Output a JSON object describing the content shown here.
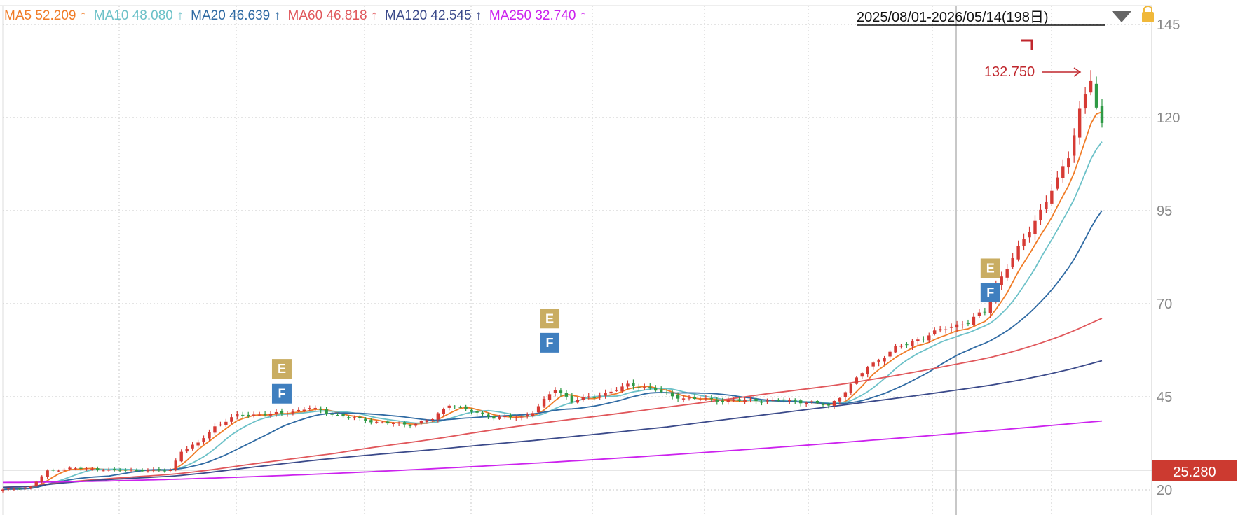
{
  "legend": [
    {
      "label": "MA5",
      "value": "52.209",
      "arrow": "↑",
      "color": "#f07c27"
    },
    {
      "label": "MA10",
      "value": "48.080",
      "arrow": "↑",
      "color": "#6cc1c8"
    },
    {
      "label": "MA20",
      "value": "46.639",
      "arrow": "↑",
      "color": "#2f6aa3"
    },
    {
      "label": "MA60",
      "value": "46.818",
      "arrow": "↑",
      "color": "#e0575b"
    },
    {
      "label": "MA120",
      "value": "42.545",
      "arrow": "↑",
      "color": "#3b4a8a"
    },
    {
      "label": "MA250",
      "value": "32.740",
      "arrow": "↑",
      "color": "#cc22ee"
    }
  ],
  "range_label": "2025/08/01-2026/05/14(198日)",
  "dropdown_icon": "triangle-down-icon",
  "lock_icon": "lock-icon",
  "high_label": "132.750",
  "current_price": "25.280",
  "colors": {
    "up": "#d63a34",
    "down": "#2e9a45",
    "price_tag": "#cc3a30",
    "marker_E": "#c9ad62",
    "marker_F": "#3f7fbf"
  },
  "markers": [
    {
      "label": "E",
      "index": 50,
      "price": 52.5
    },
    {
      "label": "F",
      "index": 50,
      "price": 45.8
    },
    {
      "label": "E",
      "index": 98,
      "price": 66.0
    },
    {
      "label": "F",
      "index": 98,
      "price": 59.5
    },
    {
      "label": "E",
      "index": 177,
      "price": 79.5
    },
    {
      "label": "F",
      "index": 177,
      "price": 73.0
    }
  ],
  "chart_data": {
    "type": "candlestick",
    "title": "",
    "xlabel": "",
    "ylabel": "",
    "ylim": [
      17,
      146
    ],
    "y_ticks": [
      20,
      45,
      70,
      95,
      120,
      145
    ],
    "n_bars": 198,
    "high": 132.75,
    "series": [
      {
        "name": "MA5",
        "current": 52.209
      },
      {
        "name": "MA10",
        "current": 48.08
      },
      {
        "name": "MA20",
        "current": 46.639
      },
      {
        "name": "MA60",
        "current": 46.818
      },
      {
        "name": "MA120",
        "current": 42.545
      },
      {
        "name": "MA250",
        "current": 32.74
      }
    ],
    "close_path": [
      [
        0,
        20.0
      ],
      [
        5,
        20.8
      ],
      [
        8,
        25.0
      ],
      [
        12,
        25.8
      ],
      [
        20,
        25.3
      ],
      [
        30,
        25.2
      ],
      [
        32,
        30.5
      ],
      [
        35,
        32.5
      ],
      [
        38,
        37.0
      ],
      [
        42,
        40.0
      ],
      [
        50,
        40.5
      ],
      [
        55,
        42.0
      ],
      [
        60,
        40.0
      ],
      [
        68,
        38.0
      ],
      [
        73,
        37.5
      ],
      [
        77,
        39.0
      ],
      [
        80,
        43.0
      ],
      [
        84,
        41.0
      ],
      [
        88,
        39.5
      ],
      [
        93,
        39.5
      ],
      [
        95,
        41.0
      ],
      [
        99,
        47.0
      ],
      [
        102,
        44.0
      ],
      [
        106,
        45.0
      ],
      [
        112,
        48.0
      ],
      [
        116,
        47.5
      ],
      [
        120,
        45.0
      ],
      [
        128,
        44.0
      ],
      [
        135,
        44.0
      ],
      [
        140,
        44.0
      ],
      [
        145,
        43.5
      ],
      [
        148,
        42.5
      ],
      [
        150,
        45.0
      ],
      [
        155,
        53.0
      ],
      [
        160,
        58.0
      ],
      [
        165,
        61.0
      ],
      [
        170,
        64.0
      ],
      [
        173,
        65.0
      ],
      [
        176,
        68.0
      ],
      [
        178,
        75.0
      ],
      [
        181,
        82.0
      ],
      [
        184,
        90.0
      ],
      [
        186,
        95.0
      ],
      [
        189,
        103.0
      ],
      [
        191,
        110.0
      ],
      [
        193,
        122.0
      ],
      [
        195,
        130.0
      ],
      [
        196,
        122.0
      ],
      [
        197,
        118.5
      ]
    ],
    "ma_end_values": {
      "MA5": 121.5,
      "MA10": 113.5,
      "MA20": 95.0,
      "MA60": 64.0,
      "MA120": 53.5,
      "MA250": 38.5
    }
  }
}
